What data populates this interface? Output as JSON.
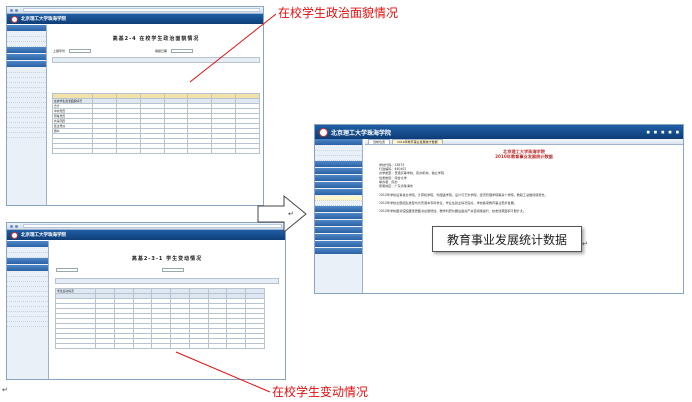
{
  "labels": {
    "political_status": "在校学生政治面貌情况",
    "student_changes": "在校学生变动情况",
    "stats_data": "教育事业发展统计数据"
  },
  "app": {
    "name": "北京理工大学珠海学院"
  },
  "screen_top": {
    "doc_title": "高基2-4 在校学生政治面貌情况",
    "filter_label_1": "上报年份",
    "filter_label_2": "填报日期",
    "col_left": "在校学生政治面貌情况",
    "rows": [
      "合计",
      "中共党员",
      "预备党员",
      "共青团员",
      "民主党派",
      "群众"
    ]
  },
  "screen_bottom": {
    "doc_title": "高基2-3-1 学生变动情况",
    "col_left": "学生变动情况"
  },
  "screen_right": {
    "tabs": [
      "当前位置",
      "2010年教育事业发展统计数据"
    ],
    "report_header_1": "北京理工大学珠海学院",
    "report_header_2": "2010年教育事业发展统计数据",
    "meta": [
      "学校代码：13675",
      "行政编码：440402",
      "办学类型：普通高等学校、民办机构、独立学院",
      "性质类别：综合大学",
      "举办者：民办",
      "所属地区：广东省珠海市"
    ],
    "paragraphs": [
      "2010年学校设有信息学院、计算机学院、外国语学院、设计与艺术学院、经济管理学院等多个学院，教职工总数持续增长。",
      "2010年学校全部招生类型均为普通本专科学生，毕业生就业情况良好，学校各项教育事业稳步发展。",
      "2010年学校图书馆馆藏纸质图书总量增加，教学科研仪器设备资产总值持续提升，校舍建筑面积不断扩大。"
    ]
  },
  "colors": {
    "label_red": "#e01010",
    "header_blue": "#1f5fa6",
    "table_header": "#f3e2a8"
  }
}
